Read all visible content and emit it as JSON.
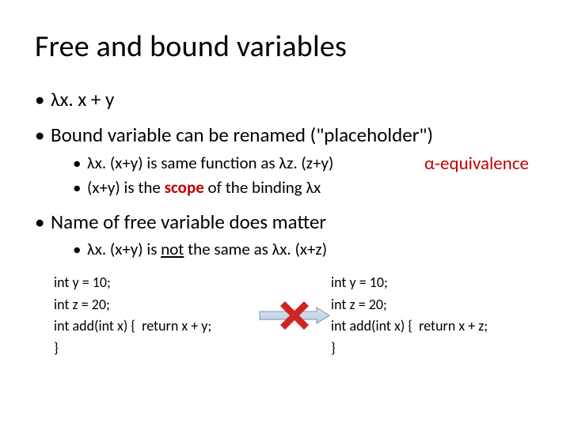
{
  "title": "Free and bound variables",
  "bullets": {
    "b1": "λx. x + y",
    "b2": "Bound variable can be renamed (\"placeholder\")",
    "b2sub": {
      "s1a": "λx. (x+y) is same function as λz. (z+y)",
      "s1b": "α-equivalence",
      "s2a": "(x+y) is the ",
      "s2scope": "scope",
      "s2b": " of the binding λx"
    },
    "b3": "Name of free variable does matter",
    "b3sub": {
      "s1a": "λx. (x+y) is ",
      "s1not": "not",
      "s1b": " the same as λx. (x+z)"
    }
  },
  "code_left": {
    "l1": "int y = 10;",
    "l2": "int z = 20;",
    "l3": "int add(int x) {  return x + y;",
    "l4": "}"
  },
  "code_right": {
    "l1": "int y = 10;",
    "l2": "int z = 20;",
    "l3": "int add(int x) {  return x + z;",
    "l4": "}"
  }
}
